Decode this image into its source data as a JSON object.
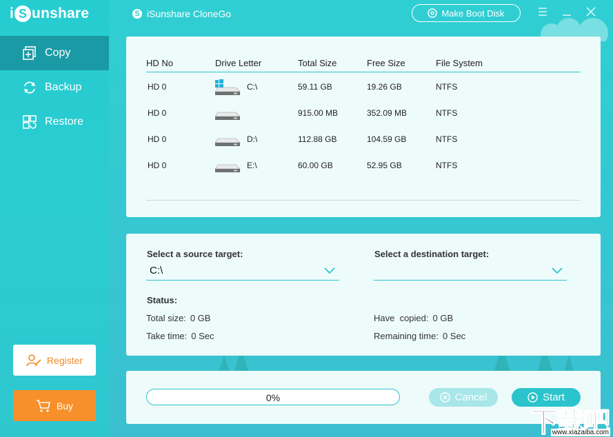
{
  "brand": {
    "logo_prefix": "i",
    "logo_s": "S",
    "logo_suffix": "unshare"
  },
  "titlebar": {
    "app_title": "iSunshare CloneGo",
    "boot_button": "Make Boot Disk",
    "menu_icon": "hamburger-icon",
    "minimize_icon": "minimize-icon",
    "close_icon": "close-icon"
  },
  "sidebar": {
    "items": [
      {
        "label": "Copy",
        "icon": "copy-icon",
        "active": true
      },
      {
        "label": "Backup",
        "icon": "backup-icon",
        "active": false
      },
      {
        "label": "Restore",
        "icon": "restore-icon",
        "active": false
      }
    ],
    "register_label": "Register",
    "buy_label": "Buy"
  },
  "drive_table": {
    "columns": [
      "HD No",
      "Drive Letter",
      "Total Size",
      "Free Size",
      "File System"
    ],
    "rows": [
      {
        "hd": "HD 0",
        "letter": "C:\\",
        "total": "59.11 GB",
        "free": "19.26 GB",
        "fs": "NTFS",
        "icon": "windows-disk-icon"
      },
      {
        "hd": "HD 0",
        "letter": "",
        "total": "915.00 MB",
        "free": "352.09 MB",
        "fs": "NTFS",
        "icon": "disk-icon"
      },
      {
        "hd": "HD 0",
        "letter": "D:\\",
        "total": "112.88 GB",
        "free": "104.59 GB",
        "fs": "NTFS",
        "icon": "disk-icon"
      },
      {
        "hd": "HD 0",
        "letter": "E:\\",
        "total": "60.00 GB",
        "free": "52.95 GB",
        "fs": "NTFS",
        "icon": "disk-icon"
      }
    ]
  },
  "targets": {
    "source_label": "Select a source target:",
    "source_value": "C:\\",
    "destination_label": "Select a destination target:",
    "destination_value": ""
  },
  "status": {
    "heading": "Status:",
    "total_size_label": "Total size:",
    "total_size_value": "0 GB",
    "take_time_label": "Take time:",
    "take_time_value": "0 Sec",
    "have_copied_label": "Have  copied:",
    "have_copied_value": "0 GB",
    "remaining_label": "Remaining time:",
    "remaining_value": "0 Sec"
  },
  "progress": {
    "percent_text": "0%",
    "fraction": 0
  },
  "actions": {
    "cancel_label": "Cancel",
    "start_label": "Start"
  },
  "watermark": {
    "big": "下载吧",
    "small": "www.xiazaiba.com"
  },
  "colors": {
    "accent": "#2bc4cc",
    "sidebar_active": "#1a9aa5",
    "buy": "#f7902a",
    "register_text": "#f08a26",
    "panel": "#eefbfb"
  }
}
